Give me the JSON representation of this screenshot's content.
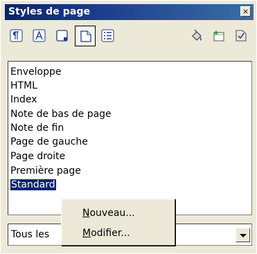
{
  "window": {
    "title": "Styles de page",
    "close_glyph": "×"
  },
  "toolbar": {
    "buttons": [
      {
        "name": "paragraph-styles-icon",
        "active": false
      },
      {
        "name": "character-styles-icon",
        "active": false
      },
      {
        "name": "frame-styles-icon",
        "active": false
      },
      {
        "name": "page-styles-icon",
        "active": true
      },
      {
        "name": "list-styles-icon",
        "active": false
      },
      {
        "name": "fill-format-mode-icon",
        "active": false
      },
      {
        "name": "new-style-from-selection-icon",
        "active": false
      },
      {
        "name": "update-style-icon",
        "active": false
      }
    ]
  },
  "styles_list": {
    "items": [
      "Enveloppe",
      "HTML",
      "Index",
      "Note de bas de page",
      "Note de fin",
      "Page de gauche",
      "Page droite",
      "Première page",
      "Standard"
    ],
    "selected": "Standard"
  },
  "filter": {
    "value": "Tous les"
  },
  "context_menu": {
    "items": [
      {
        "accel": "N",
        "rest": "ouveau..."
      },
      {
        "accel": "M",
        "rest": "odifier..."
      }
    ]
  },
  "colors": {
    "titlebar": "#0a246a",
    "selection": "#0a246a",
    "face": "#ece9d8"
  }
}
